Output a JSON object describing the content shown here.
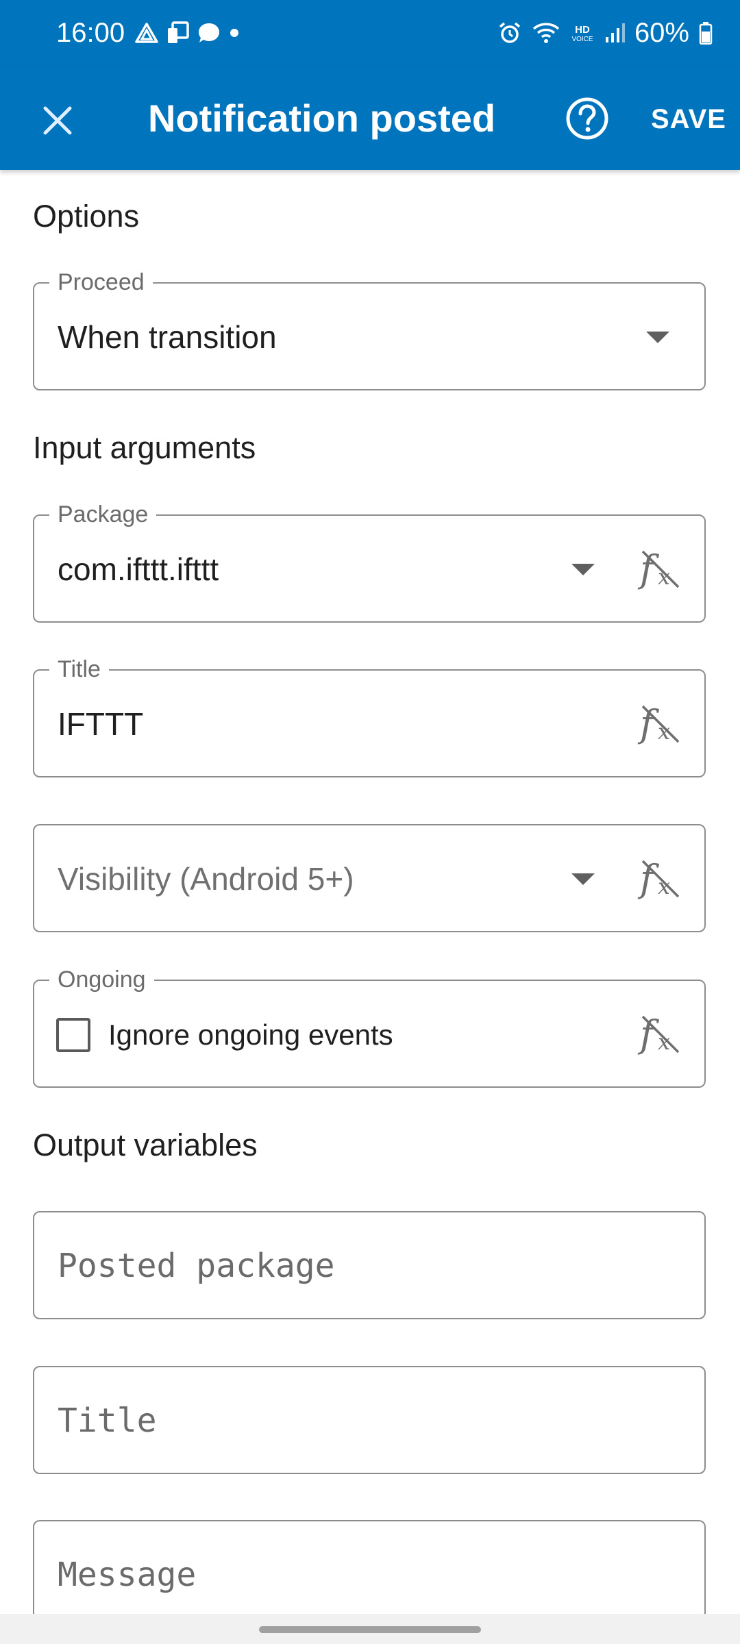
{
  "status_bar": {
    "time": "16:00",
    "battery": "60%",
    "icons_left": [
      "drive-icon",
      "cast-icon",
      "chat-icon",
      "dot-icon"
    ],
    "icons_right": [
      "alarm-icon",
      "wifi-icon",
      "hd-voice-icon",
      "signal-icon",
      "battery-icon"
    ]
  },
  "app_bar": {
    "title": "Notification posted",
    "save_label": "SAVE",
    "icons": [
      "close-icon",
      "help-icon"
    ]
  },
  "options": {
    "section_title": "Options",
    "proceed": {
      "label": "Proceed",
      "value": "When transition"
    }
  },
  "input_arguments": {
    "section_title": "Input arguments",
    "package": {
      "label": "Package",
      "value": "com.ifttt.ifttt"
    },
    "title": {
      "label": "Title",
      "value": "IFTTT"
    },
    "visibility": {
      "placeholder": "Visibility (Android 5+)"
    },
    "ongoing": {
      "label": "Ongoing",
      "checkbox_label": "Ignore ongoing events",
      "checked": false
    }
  },
  "output_variables": {
    "section_title": "Output variables",
    "fields": [
      {
        "placeholder": "Posted package"
      },
      {
        "placeholder": "Title"
      },
      {
        "placeholder": "Message"
      }
    ]
  },
  "colors": {
    "app_bar": "#0074bd",
    "border": "#8d8d8d",
    "text": "#1f1f1f",
    "label": "#6b6b6b"
  }
}
